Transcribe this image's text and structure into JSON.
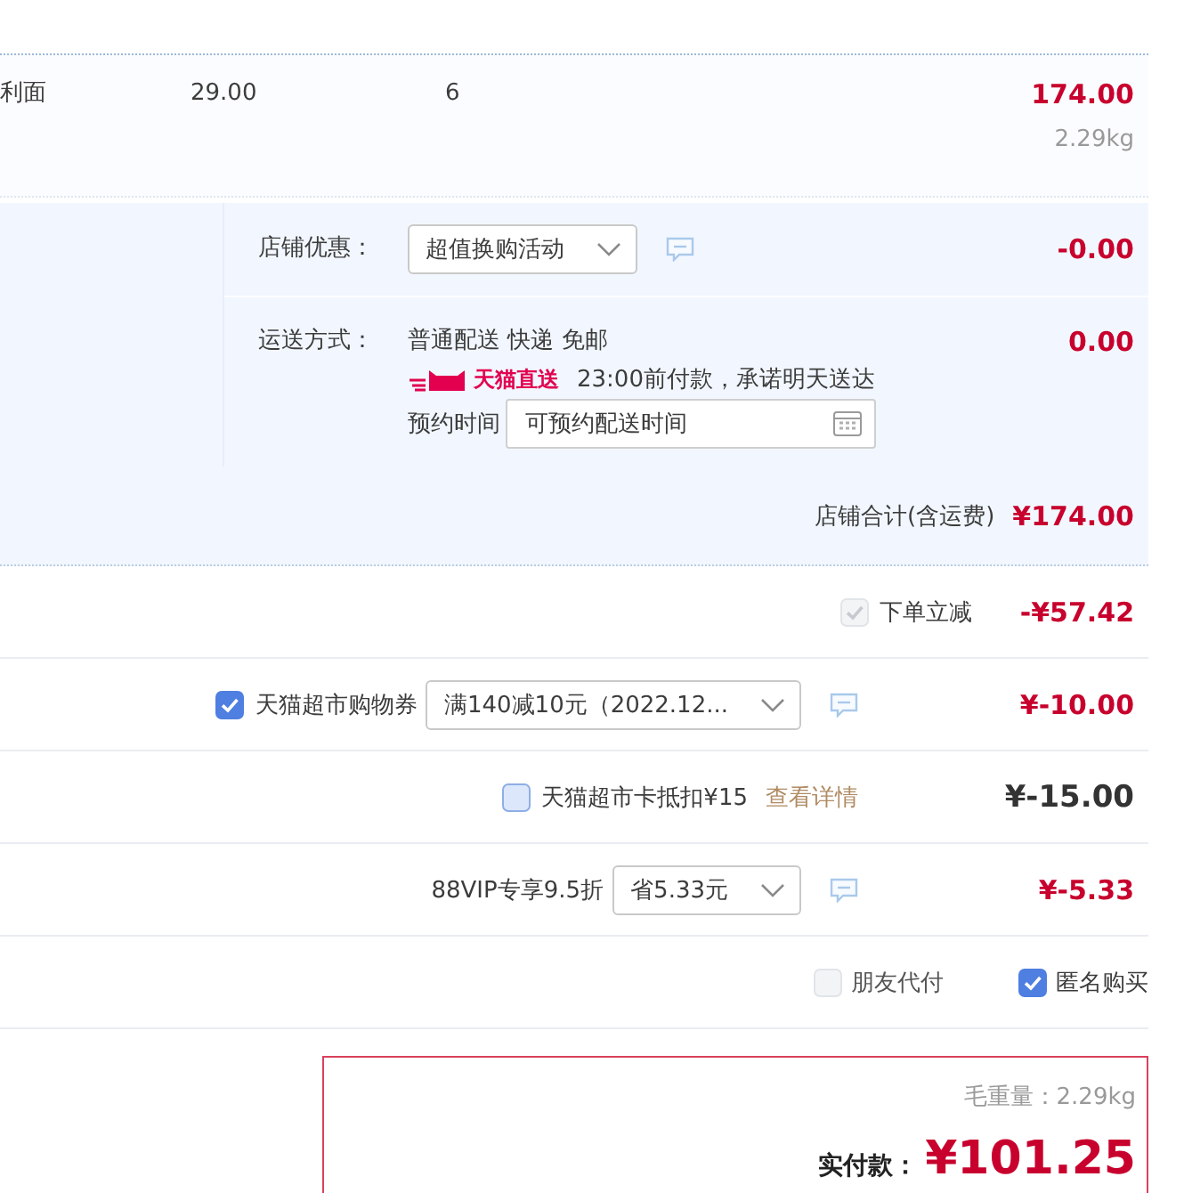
{
  "item_row": {
    "product_name": "利面",
    "unit_price": "29.00",
    "quantity": "6",
    "subtotal": "174.00",
    "weight": "2.29kg"
  },
  "shop": {
    "discount": {
      "label": "店铺优惠：",
      "selected_option": "超值换购活动",
      "amount": "-0.00"
    },
    "shipping": {
      "label": "运送方式：",
      "method": "普通配送 快递 免邮",
      "service_label": "天猫直送",
      "promise": "23:00前付款，承诺明天送达",
      "appointment_label": "预约时间",
      "appointment_field": {
        "placeholder": "可预约配送时间"
      },
      "amount": "0.00"
    },
    "total": {
      "label": "店铺合计(含运费)",
      "amount": "¥174.00"
    }
  },
  "order_adjustments": [
    {
      "kind": "instant_discount",
      "checked": true,
      "disabled": true,
      "label": "下单立减",
      "amount": "-¥57.42"
    },
    {
      "kind": "coupon",
      "checked": true,
      "disabled": false,
      "label": "天猫超市购物券",
      "selected_option": "满140减10元（2022.12...",
      "amount": "¥-10.00"
    },
    {
      "kind": "card",
      "checked": false,
      "disabled": false,
      "label": "天猫超市卡抵扣¥15",
      "link": "查看详情",
      "amount": "¥-15.00"
    },
    {
      "kind": "vip",
      "label": "88VIP专享9.5折",
      "selected_option": "省5.33元",
      "amount": "¥-5.33"
    }
  ],
  "payment_options": [
    {
      "label": "朋友代付",
      "checked": false,
      "disabled": true
    },
    {
      "label": "匿名购买",
      "checked": true,
      "disabled": false
    }
  ],
  "summary": {
    "weight": "毛重量：2.29kg",
    "pay_label": "实付款：",
    "pay_amount": "¥101.25"
  }
}
